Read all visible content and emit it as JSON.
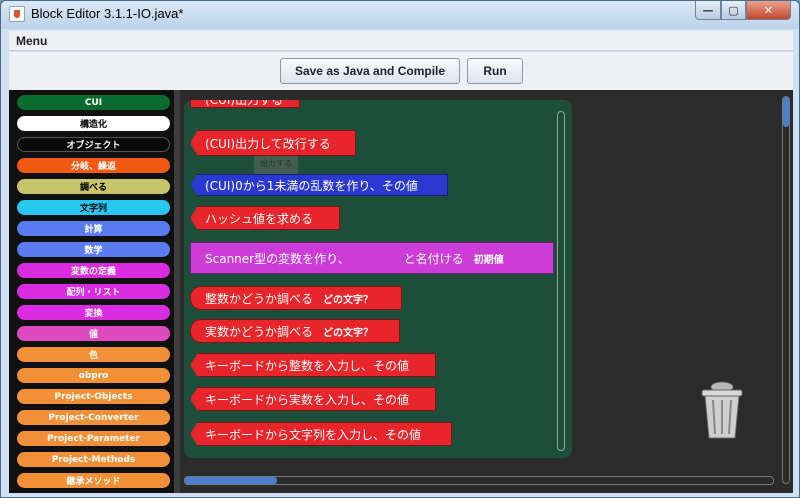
{
  "window": {
    "title": "Block Editor 3.1.1-IO.java*",
    "minimize": "—",
    "maximize": "▢",
    "close": "✕"
  },
  "menu": {
    "label": "Menu"
  },
  "toolbar": {
    "save_label": "Save as Java and Compile",
    "run_label": "Run"
  },
  "drawers": [
    {
      "label": "CUI",
      "bg": "#0b6b2e",
      "fg": "#ffffff"
    },
    {
      "label": "構造化",
      "bg": "#ffffff",
      "fg": "#000000"
    },
    {
      "label": "オブジェクト",
      "bg": "#0a0a0a",
      "fg": "#ffffff"
    },
    {
      "label": "分岐、繰返",
      "bg": "#f25a13",
      "fg": "#ffffff"
    },
    {
      "label": "調べる",
      "bg": "#c8c46a",
      "fg": "#000000"
    },
    {
      "label": "文字列",
      "bg": "#27c8f0",
      "fg": "#000000"
    },
    {
      "label": "計算",
      "bg": "#5a7cf0",
      "fg": "#ffffff"
    },
    {
      "label": "数学",
      "bg": "#5a7cf0",
      "fg": "#ffffff"
    },
    {
      "label": "変数の定義",
      "bg": "#d92be0",
      "fg": "#ffffff"
    },
    {
      "label": "配列・リスト",
      "bg": "#d92be0",
      "fg": "#ffffff"
    },
    {
      "label": "変換",
      "bg": "#d92be0",
      "fg": "#ffffff"
    },
    {
      "label": "値",
      "bg": "#e04ac0",
      "fg": "#ffffff"
    },
    {
      "label": "色",
      "bg": "#f29038",
      "fg": "#ffffff"
    },
    {
      "label": "obpro",
      "bg": "#f29038",
      "fg": "#ffffff"
    },
    {
      "label": "Project-Objects",
      "bg": "#f29038",
      "fg": "#ffffff"
    },
    {
      "label": "Project-Converter",
      "bg": "#f29038",
      "fg": "#ffffff"
    },
    {
      "label": "Project-Parameter",
      "bg": "#f29038",
      "fg": "#ffffff"
    },
    {
      "label": "Project-Methods",
      "bg": "#f29038",
      "fg": "#ffffff"
    },
    {
      "label": "継承メソッド",
      "bg": "#f29038",
      "fg": "#ffffff"
    }
  ],
  "blocks": {
    "partial_top": "(CUI)出力する",
    "print_line": "(CUI)出力して改行する",
    "random": "(CUI)0から1未満の乱数を作り、その値",
    "hash": "ハッシュ値を求める",
    "scanner": "Scanner型の変数を作り、　　　　　と名付ける",
    "scanner_tag": "初期値",
    "is_int": "整数かどうか調べる",
    "is_int_tag": "どの文字？",
    "is_real": "実数かどうか調べる",
    "is_real_tag": "どの文字？",
    "read_int": "キーボードから整数を入力し、その値",
    "read_real": "キーボードから実数を入力し、その値",
    "read_str": "キーボードから文字列を入力し、その値"
  },
  "icons": {
    "trash": "trash-can-icon",
    "app": "java-icon"
  }
}
